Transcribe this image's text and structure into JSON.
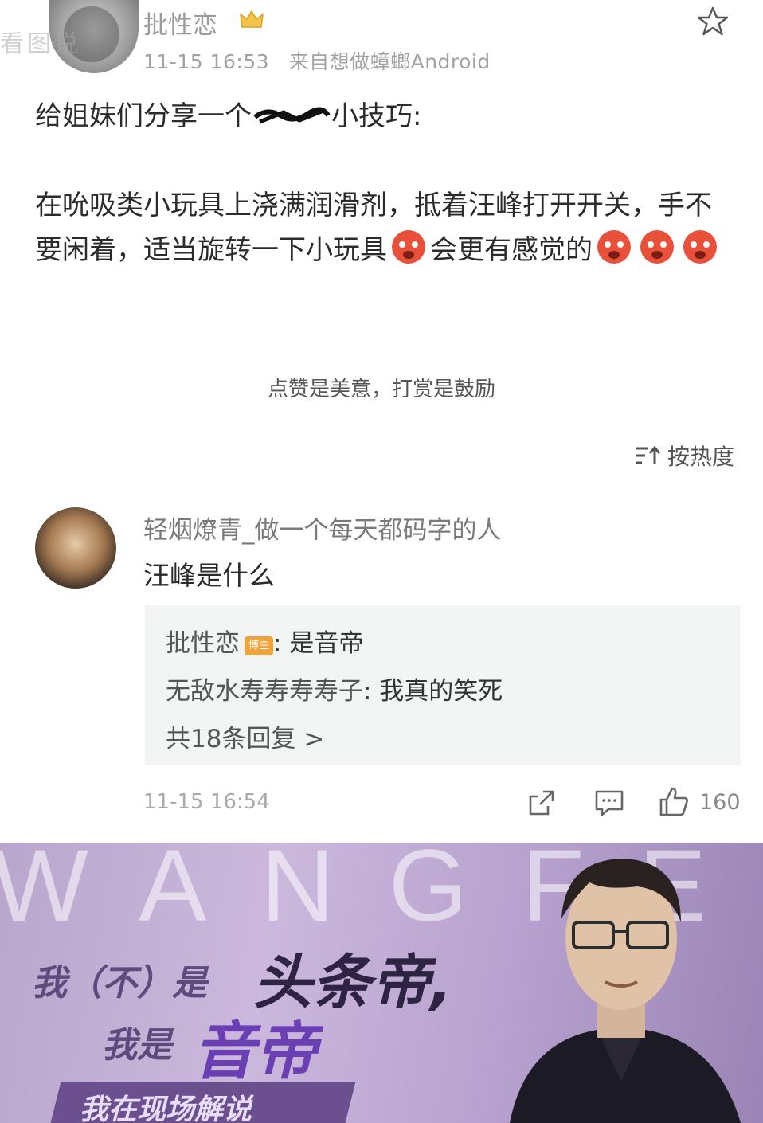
{
  "watermark": "看图说",
  "post": {
    "author_name": "批性恋",
    "timestamp": "11-15 16:53",
    "source": "来自想做蟑螂Android",
    "line1_before": "给姐妹们分享一个",
    "line1_after": "小技巧:",
    "line2": "在吮吸类小玩具上浇满润滑剂，抵着汪峰打开开关，手不要闲着，适当旋转一下小玩具",
    "line2_after": "会更有感觉的",
    "reward_text": "点赞是美意，打赏是鼓励",
    "sort_label": "按热度"
  },
  "comment": {
    "user": "轻烟燎青_做一个每天都码字的人",
    "text": "汪峰是什么",
    "replies": [
      {
        "user": "批性恋",
        "badge": "博主",
        "text": ": 是音帝"
      },
      {
        "user": "无敌水寿寿寿寿子",
        "text": ": 我真的笑死"
      }
    ],
    "more_replies": "共18条回复 >",
    "timestamp": "11-15 16:54",
    "like_count": "160"
  },
  "banner": {
    "bg_text": "WANGFENG",
    "line1_prefix": "我（不）是",
    "line1_big": "头条帝,",
    "line2_prefix": "我是",
    "line2_big": "音帝",
    "line3": "我在现场解说"
  },
  "colors": {
    "badge": "#f0a33a",
    "reply_bg": "#f3f5f4",
    "banner_purple": "#b9a6cd"
  }
}
